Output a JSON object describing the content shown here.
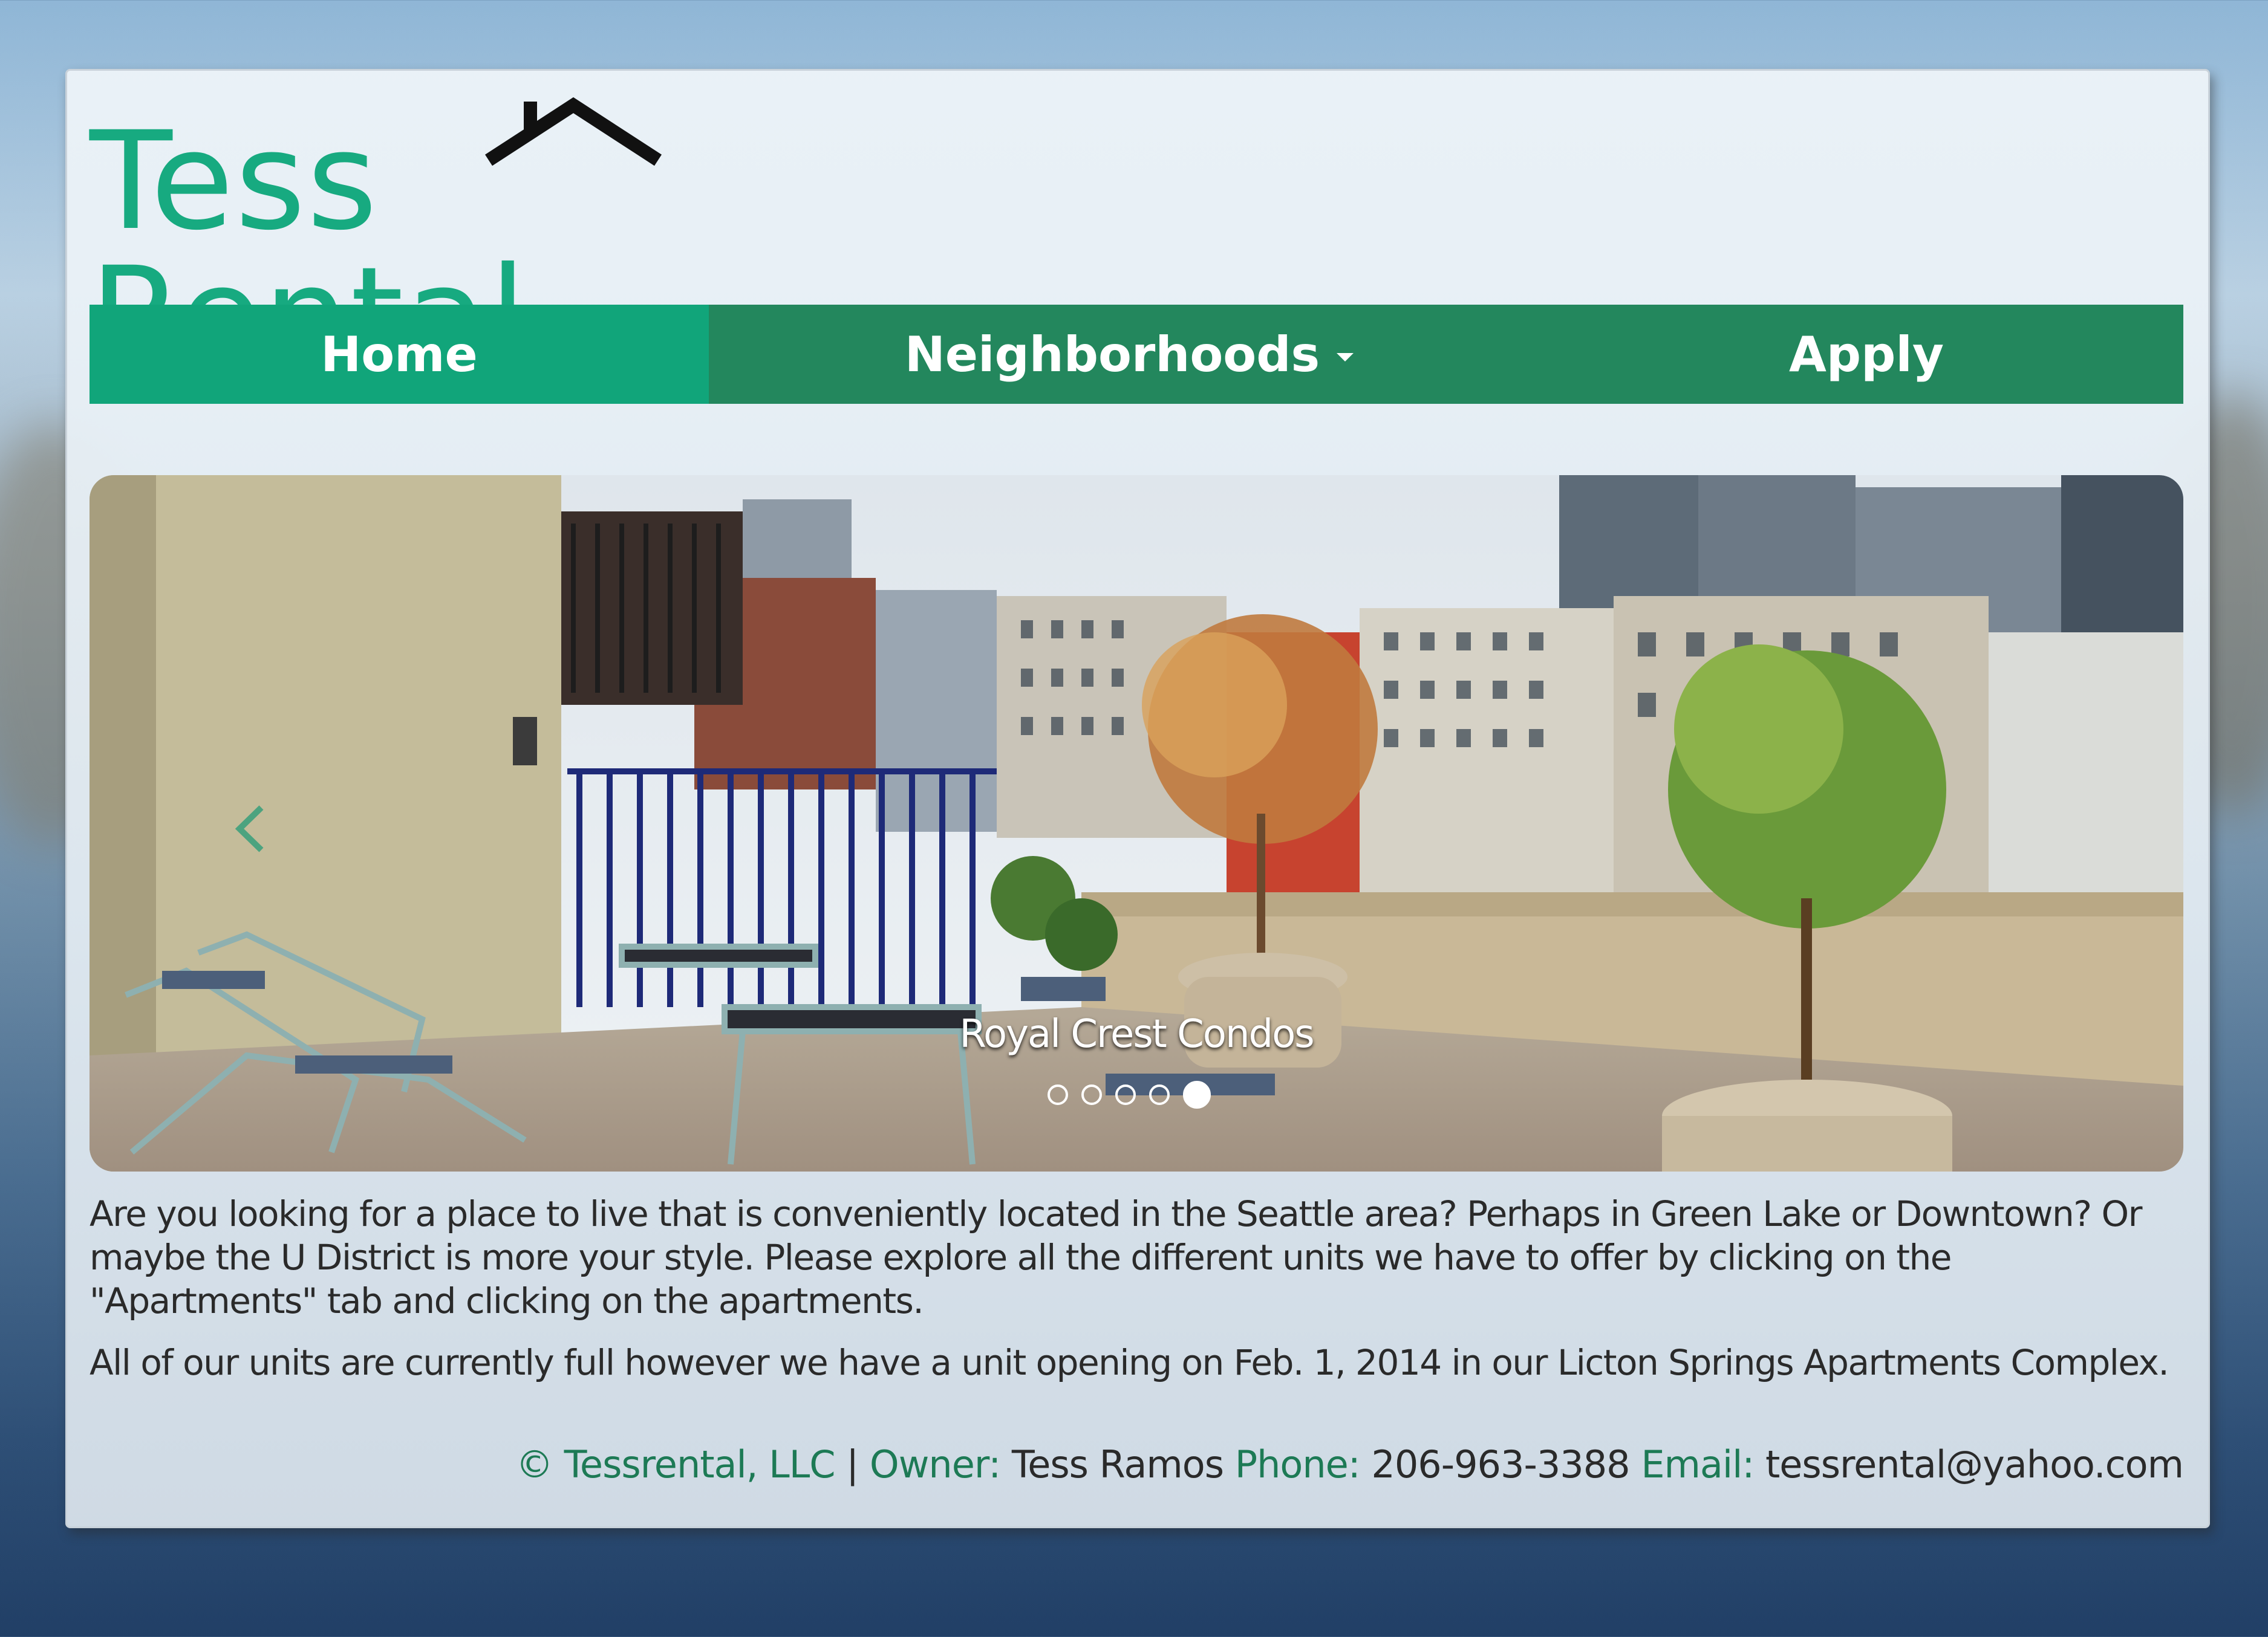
{
  "brand": {
    "name": "Tess Rental",
    "color": "#17aa80",
    "roof_color": "#111111"
  },
  "nav": {
    "items": [
      {
        "label": "Home",
        "active": true
      },
      {
        "label": "Neighborhoods",
        "has_dropdown": true
      },
      {
        "label": "Apply"
      }
    ],
    "colors": {
      "bar": "#23875d",
      "active": "#11a57a",
      "text": "#ffffff"
    }
  },
  "carousel": {
    "caption": "Royal Crest Condos",
    "slide_count": 5,
    "active_index": 4,
    "prev_icon": "chevron-left-icon"
  },
  "content": {
    "intro": "Are you looking for a place to live that is conveniently located in the Seattle area? Perhaps in Green Lake or Downtown? Or maybe the U District is more your style. Please explore all the different units we have to offer by clicking on the \"Apartments\" tab and clicking on the apartments.",
    "notice": "All of our units are currently full however we have a unit opening on Feb. 1, 2014 in our Licton Springs Apartments Complex."
  },
  "footer": {
    "company": "© Tessrental, LLC",
    "separator": "|",
    "owner_label": "Owner:",
    "owner": "Tess Ramos",
    "phone_label": "Phone:",
    "phone": "206-963-3388",
    "email_label": "Email:",
    "email": "tessrental@yahoo.com"
  }
}
